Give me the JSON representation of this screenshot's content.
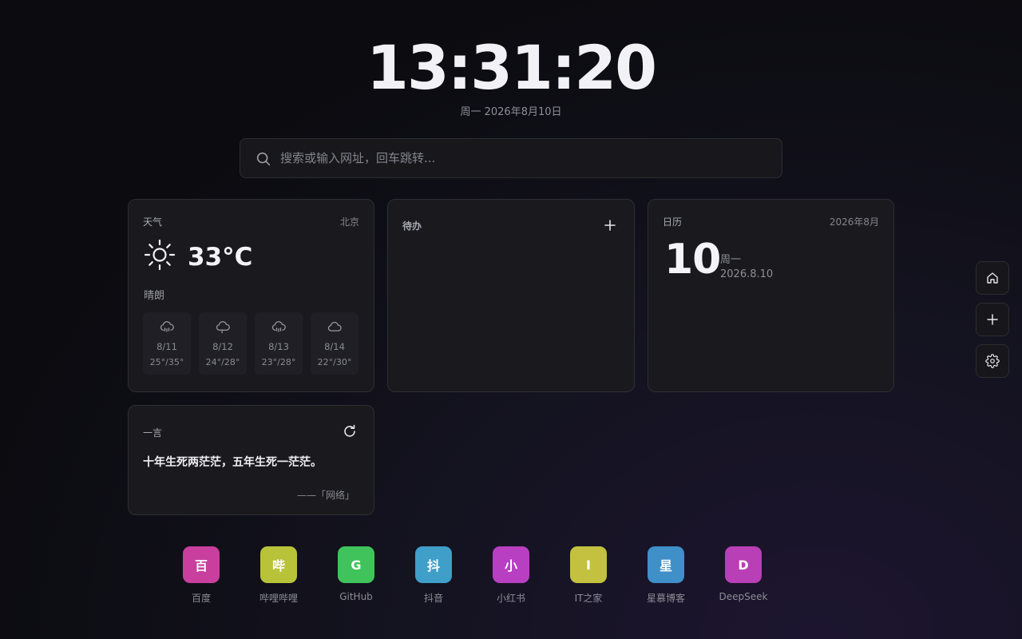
{
  "clock": {
    "time": "13:31:20",
    "date": "周一  2026年8月10日"
  },
  "search": {
    "placeholder": "搜索或输入网址，回车跳转..."
  },
  "weather": {
    "title": "天气",
    "city": "北京",
    "temp": "33°C",
    "condition": "晴朗",
    "forecast": [
      {
        "date": "8/11",
        "temp": "25°/35°",
        "icon": "cloud-rain-icon"
      },
      {
        "date": "8/12",
        "temp": "24°/28°",
        "icon": "cloud-drizzle-icon"
      },
      {
        "date": "8/13",
        "temp": "23°/28°",
        "icon": "cloud-rain-icon"
      },
      {
        "date": "8/14",
        "temp": "22°/30°",
        "icon": "cloud-icon"
      }
    ]
  },
  "todo": {
    "title": "待办"
  },
  "calendar": {
    "title": "日历",
    "month": "2026年8月",
    "day": "10",
    "weekday": "周一",
    "full_date": "2026.8.10"
  },
  "quote": {
    "title": "一言",
    "text": "十年生死两茫茫，五年生死一茫茫。",
    "source": "——「网络」"
  },
  "shortcuts": [
    {
      "label": "百度",
      "glyph": "百",
      "color": "#c83f9e"
    },
    {
      "label": "哔哩哔哩",
      "glyph": "哔",
      "color": "#b9c33a"
    },
    {
      "label": "GitHub",
      "glyph": "G",
      "color": "#3fc35a"
    },
    {
      "label": "抖音",
      "glyph": "抖",
      "color": "#3f9fc8"
    },
    {
      "label": "小红书",
      "glyph": "小",
      "color": "#b83fc1"
    },
    {
      "label": "IT之家",
      "glyph": "I",
      "color": "#c3c13f"
    },
    {
      "label": "星慕博客",
      "glyph": "星",
      "color": "#3f8fc8"
    },
    {
      "label": "DeepSeek",
      "glyph": "D",
      "color": "#b83fb5"
    }
  ],
  "colors": {
    "background": "#0c0c11",
    "card": "#19191e",
    "border": "#2e2e35",
    "text": "#e9e9ee"
  },
  "side_icons": [
    "home-icon",
    "plus-icon",
    "gear-icon"
  ]
}
